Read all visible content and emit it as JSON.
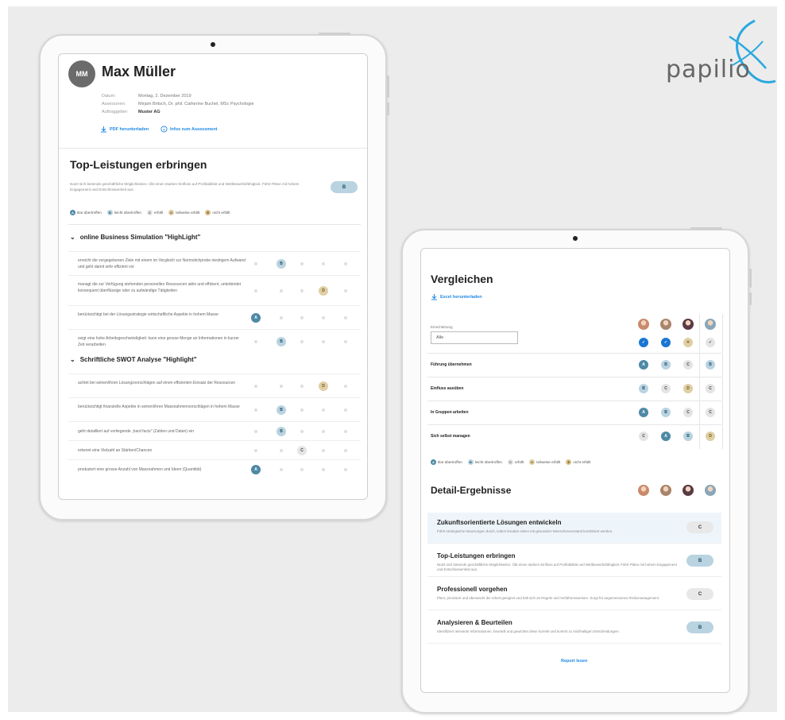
{
  "logo": {
    "text": "papilio"
  },
  "left": {
    "avatar_initials": "MM",
    "name": "Max Müller",
    "meta": [
      {
        "key": "Datum:",
        "value": "Montag, 2. Dezember 2019"
      },
      {
        "key": "Assessoren:",
        "value": "Mirjam Britsch, Dr. phil. Catherine Buchel, MSc Psychologie"
      },
      {
        "key": "Auftraggeber:",
        "value": "Muster AG"
      }
    ],
    "links": {
      "pdf": "PDF herunterladen",
      "info": "Infos zum Assessment"
    },
    "section_title": "Top-Leistungen erbringen",
    "section_desc": "Nutzt sich bietende geschäftliche Möglichkeiten. Übt einen starken Einfluss auf Profitabilität und Wettbewerbsfähigkeit. Führt Pläne mit hohem Engagement und Entschlossenheit aus.",
    "section_grade": "B",
    "legend": [
      {
        "letter": "A",
        "label": "klar übertroffen"
      },
      {
        "letter": "B",
        "label": "leicht übertroffen"
      },
      {
        "letter": "C",
        "label": "erfüllt"
      },
      {
        "letter": "D",
        "label": "teilweise erfüllt"
      },
      {
        "letter": "E",
        "label": "nicht erfüllt"
      }
    ],
    "groups": [
      {
        "title": "online Business Simulation \"HighLight\"",
        "rows": [
          {
            "text": "erreicht die vorgegebenen Ziele mit einem im Vergleich zur Normstichprobe niedrigem Aufwand und geht damit sehr effizient vor",
            "grade": "B"
          },
          {
            "text": "managt die zur Verfügung stehenden personellen Ressourcen aktiv und effizient, unterbindet konsequent überflüssige oder zu aufwändige Tätigkeiten",
            "grade": "D"
          },
          {
            "text": "berücksichtigt bei der Lösungsstrategie wirtschaftliche Aspekte in hohem Masse",
            "grade": "A"
          },
          {
            "text": "zeigt eine hohe Arbeitsgeschwindigkeit: kann eine grosse Menge an Informationen in kurzer Zeit verarbeiten",
            "grade": "B"
          }
        ]
      },
      {
        "title": "Schriftliche SWOT Analyse \"Highlight\"",
        "rows": [
          {
            "text": "achtet bei seinen/ihren Lösungsvorschlägen auf einen effizienten Einsatz der Ressourcen",
            "grade": "D"
          },
          {
            "text": "berücksichtigt finanzielle Aspekte in seinen/ihren Massnahmenvorschlägen in hohem Masse",
            "grade": "B"
          },
          {
            "text": "geht detailliert auf vorliegende „hard facts\" (Zahlen und Daten) ein",
            "grade": "B"
          },
          {
            "text": "erkennt eine Vielzahl an Stärken/Chancen",
            "grade": "C"
          },
          {
            "text": "produziert eine grosse Anzahl von Massnahmen und Ideen (Quantität)",
            "grade": "A"
          }
        ]
      }
    ]
  },
  "right": {
    "title": "Vergleichen",
    "excel_link": "Excel herunterladen",
    "filter_label": "Einschätzung",
    "filter_value": "Alle",
    "header_marks": [
      "✓",
      "✓",
      "✕",
      "✓"
    ],
    "rows": [
      {
        "label": "Führung übernehmen",
        "grades": [
          "A",
          "B",
          "C",
          "B"
        ]
      },
      {
        "label": "Einfluss ausüben",
        "grades": [
          "B",
          "C",
          "D",
          "C"
        ]
      },
      {
        "label": "In Gruppen arbeiten",
        "grades": [
          "A",
          "B",
          "C",
          "C"
        ]
      },
      {
        "label": "Sich selbst managen",
        "grades": [
          "C",
          "A",
          "B",
          "D"
        ]
      }
    ],
    "detail_title": "Detail-Ergebnisse",
    "details": [
      {
        "title": "Zukunftsorientierte Lösungen entwickeln",
        "desc": "Führt strategische Neuerungen durch, indem kreative Ideen mit gesundem Menschenverstand kombiniert werden.",
        "grade": "C"
      },
      {
        "title": "Top-Leistungen erbringen",
        "desc": "Nutzt sich bietende geschäftliche Möglichkeiten. Übt einen starken Einfluss auf Profitabilität und Wettbewerbsfähigkeit. Führt Pläne mit hohem Engagement und Entschlossenheit aus.",
        "grade": "B"
      },
      {
        "title": "Professionell vorgehen",
        "desc": "Plant, priorisiert und überwacht die Arbeit geeignet und hält sich an Regeln und Verfahrensweisen. Sorgt für angemessenes Risikomanagement.",
        "grade": "C"
      },
      {
        "title": "Analysieren & Beurteilen",
        "desc": "Identifiziert relevante Informationen, beurteilt und gewichtet diese korrekt und kommt zu stichhaltigen Entscheidungen.",
        "grade": "B"
      }
    ],
    "report_link": "Report lesen"
  },
  "colors": {
    "accent": "#1e88e5",
    "gradeA": "#4e89a5",
    "gradeB": "#bad3e0",
    "gradeC": "#e4e4e4",
    "gradeD": "#e0cfa4"
  }
}
